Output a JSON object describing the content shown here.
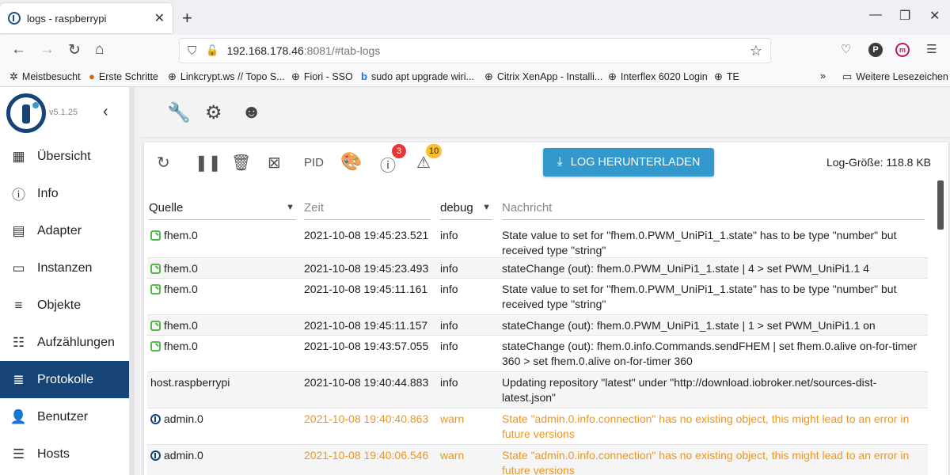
{
  "browser": {
    "tab_title": "logs - raspberrypi",
    "new_tab": "+",
    "url_host": "192.168.178.46",
    "url_rest": ":8081/#tab-logs",
    "bookmarks": [
      {
        "label": "Meistbesucht",
        "icon": "gear-icon"
      },
      {
        "label": "Erste Schritte",
        "icon": "firefox-icon"
      },
      {
        "label": "Linkcrypt.ws // Topo S...",
        "icon": "globe-icon"
      },
      {
        "label": "Fiori - SSO",
        "icon": "globe-icon"
      },
      {
        "label": "sudo apt upgrade wiri...",
        "icon": "bing-icon"
      },
      {
        "label": "Citrix XenApp - Installi...",
        "icon": "globe-icon"
      },
      {
        "label": "Interflex 6020 Login",
        "icon": "globe-icon"
      },
      {
        "label": "TE",
        "icon": "globe-icon"
      }
    ],
    "more_bookmarks": "Weitere Lesezeichen",
    "profile_initial": "P",
    "ext_initial": "m"
  },
  "sidebar": {
    "version": "v5.1.25",
    "items": [
      {
        "label": "Übersicht",
        "icon": "grid-icon"
      },
      {
        "label": "Info",
        "icon": "info-icon"
      },
      {
        "label": "Adapter",
        "icon": "store-icon"
      },
      {
        "label": "Instanzen",
        "icon": "instances-icon"
      },
      {
        "label": "Objekte",
        "icon": "list-icon"
      },
      {
        "label": "Aufzählungen",
        "icon": "enum-icon"
      },
      {
        "label": "Protokolle",
        "icon": "logs-icon"
      },
      {
        "label": "Benutzer",
        "icon": "user-icon"
      },
      {
        "label": "Hosts",
        "icon": "hosts-icon"
      }
    ],
    "active": "Protokolle"
  },
  "log": {
    "pid_label": "PID",
    "error_count": "3",
    "warning_count": "10",
    "download_label": "LOG HERUNTERLADEN",
    "size_label": "Log-Größe: 118.8 KB",
    "columns": {
      "source": "Quelle",
      "time": "Zeit",
      "level": "debug",
      "message": "Nachricht"
    },
    "rows": [
      {
        "source": "fhem.0",
        "time": "2021-10-08 19:45:23.521",
        "level": "info",
        "message": "State value to set for \"fhem.0.PWM_UniPi1_1.state\" has to be type \"number\" but received type \"string\""
      },
      {
        "source": "fhem.0",
        "time": "2021-10-08 19:45:23.493",
        "level": "info",
        "message": "stateChange (out): fhem.0.PWM_UniPi1_1.state | 4 > set PWM_UniPi1.1 4"
      },
      {
        "source": "fhem.0",
        "time": "2021-10-08 19:45:11.161",
        "level": "info",
        "message": "State value to set for \"fhem.0.PWM_UniPi1_1.state\" has to be type \"number\" but received type \"string\""
      },
      {
        "source": "fhem.0",
        "time": "2021-10-08 19:45:11.157",
        "level": "info",
        "message": "stateChange (out): fhem.0.PWM_UniPi1_1.state | 1 > set PWM_UniPi1.1 on"
      },
      {
        "source": "fhem.0",
        "time": "2021-10-08 19:43:57.055",
        "level": "info",
        "message": "stateChange (out): fhem.0.info.Commands.sendFHEM | set fhem.0.alive on-for-timer 360 > set fhem.0.alive on-for-timer 360"
      },
      {
        "source": "host.raspberrypi",
        "time": "2021-10-08 19:40:44.883",
        "level": "info",
        "message": "Updating repository \"latest\" under \"http://download.iobroker.net/sources-dist-latest.json\""
      },
      {
        "source": "admin.0",
        "time": "2021-10-08 19:40:40.863",
        "level": "warn",
        "message": "State \"admin.0.info.connection\" has no existing object, this might lead to an error in future versions"
      },
      {
        "source": "admin.0",
        "time": "2021-10-08 19:40:06.546",
        "level": "warn",
        "message": "State \"admin.0.info.connection\" has no existing object, this might lead to an error in future versions"
      }
    ]
  },
  "colors": {
    "brand": "#164477",
    "accent": "#3399cc",
    "warn": "#f0951b",
    "error_badge": "#e53935",
    "warning_badge": "#fbc02d"
  }
}
